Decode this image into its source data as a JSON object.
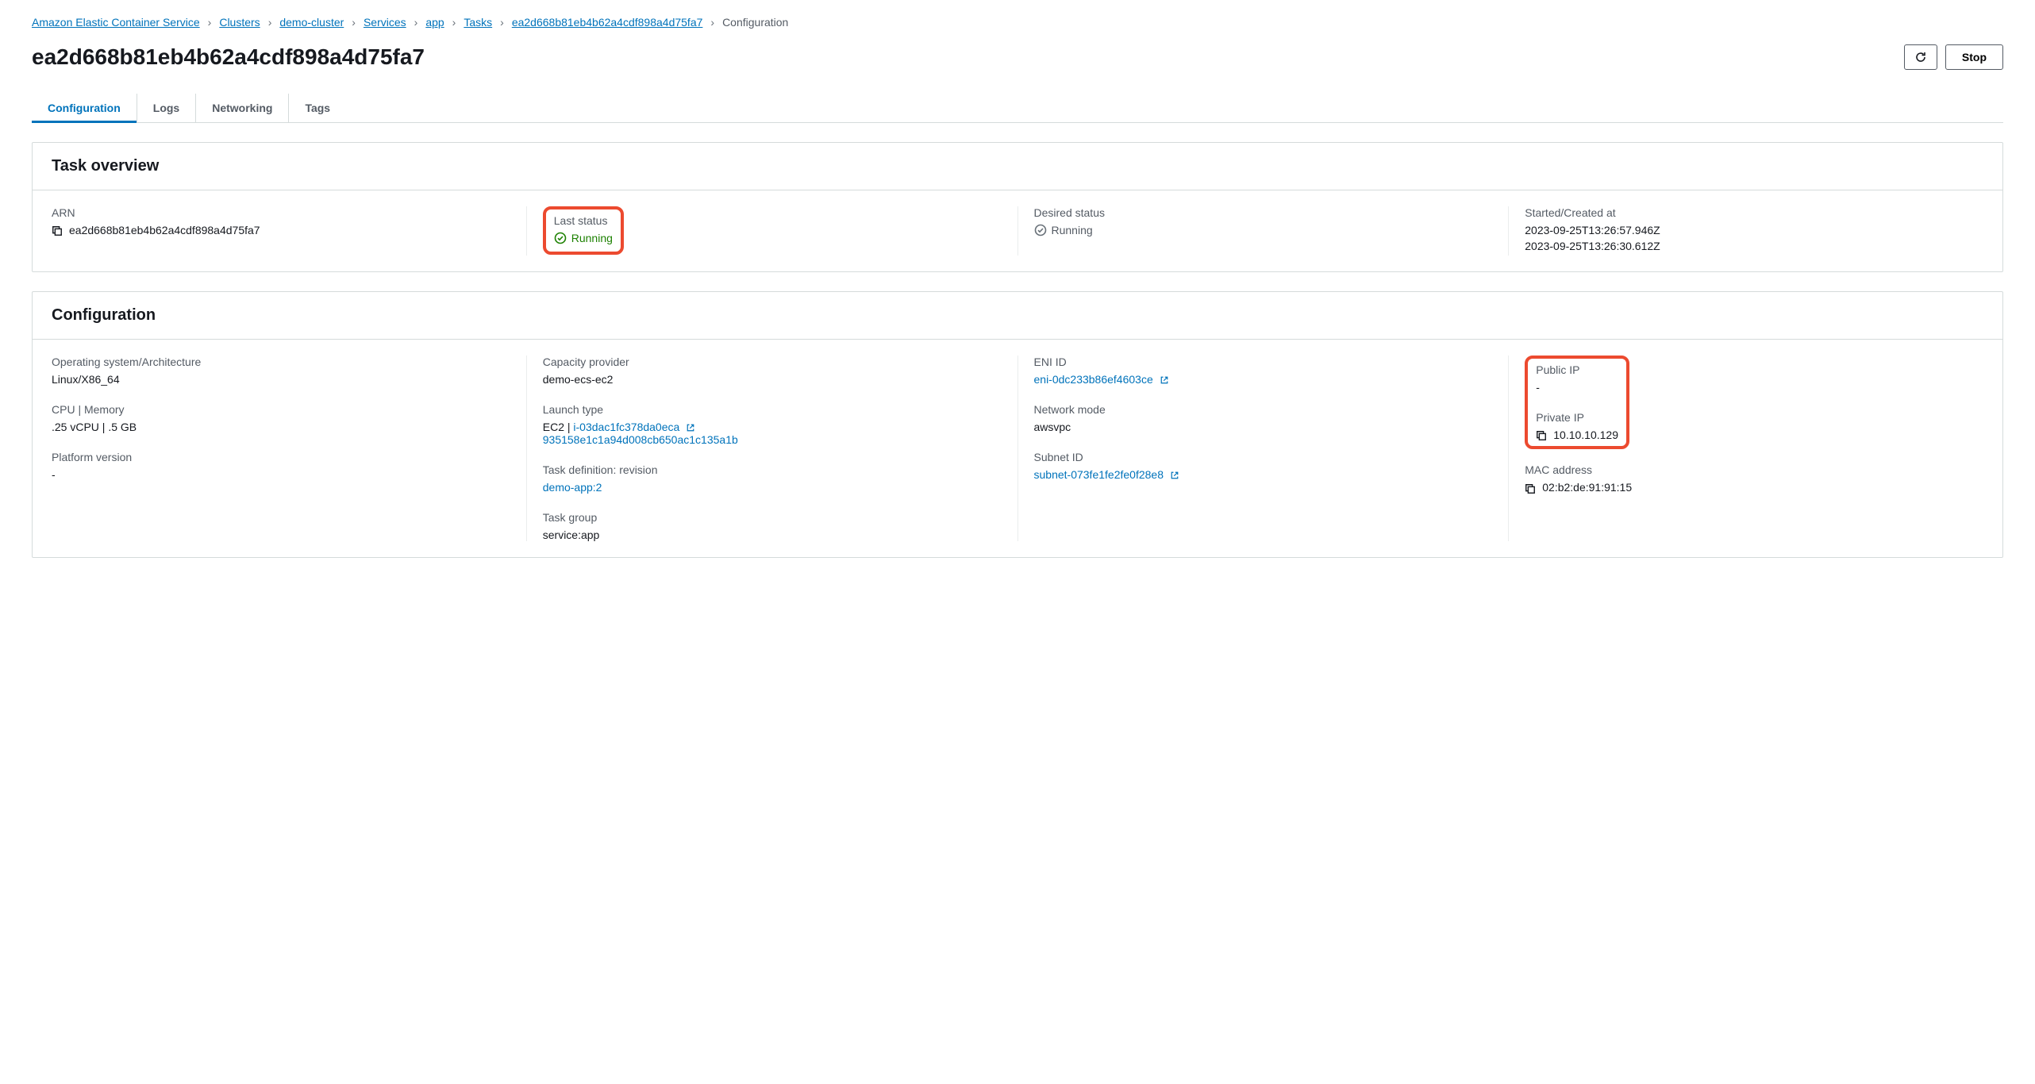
{
  "breadcrumb": {
    "items": [
      "Amazon Elastic Container Service",
      "Clusters",
      "demo-cluster",
      "Services",
      "app",
      "Tasks",
      "ea2d668b81eb4b62a4cdf898a4d75fa7"
    ],
    "current": "Configuration"
  },
  "page": {
    "title": "ea2d668b81eb4b62a4cdf898a4d75fa7",
    "stop": "Stop"
  },
  "tabs": [
    "Configuration",
    "Logs",
    "Networking",
    "Tags"
  ],
  "overview": {
    "title": "Task overview",
    "arn_label": "ARN",
    "arn_value": "ea2d668b81eb4b62a4cdf898a4d75fa7",
    "last_status_label": "Last status",
    "last_status_value": "Running",
    "desired_status_label": "Desired status",
    "desired_status_value": "Running",
    "started_label": "Started/Created at",
    "started_value1": "2023-09-25T13:26:57.946Z",
    "started_value2": "2023-09-25T13:26:30.612Z"
  },
  "config": {
    "title": "Configuration",
    "os_label": "Operating system/Architecture",
    "os_value": "Linux/X86_64",
    "cpu_label": "CPU | Memory",
    "cpu_value": ".25 vCPU | .5 GB",
    "platform_label": "Platform version",
    "platform_value": "-",
    "capacity_label": "Capacity provider",
    "capacity_value": "demo-ecs-ec2",
    "launch_label": "Launch type",
    "launch_prefix": "EC2 | ",
    "launch_link": "i-03dac1fc378da0eca",
    "launch_hash": "935158e1c1a94d008cb650ac1c135a1b",
    "taskdef_label": "Task definition: revision",
    "taskdef_value": "demo-app:2",
    "taskgroup_label": "Task group",
    "taskgroup_value": "service:app",
    "eni_label": "ENI ID",
    "eni_value": "eni-0dc233b86ef4603ce",
    "netmode_label": "Network mode",
    "netmode_value": "awsvpc",
    "subnet_label": "Subnet ID",
    "subnet_value": "subnet-073fe1fe2fe0f28e8",
    "publicip_label": "Public IP",
    "publicip_value": "-",
    "privateip_label": "Private IP",
    "privateip_value": "10.10.10.129",
    "mac_label": "MAC address",
    "mac_value": "02:b2:de:91:91:15"
  }
}
